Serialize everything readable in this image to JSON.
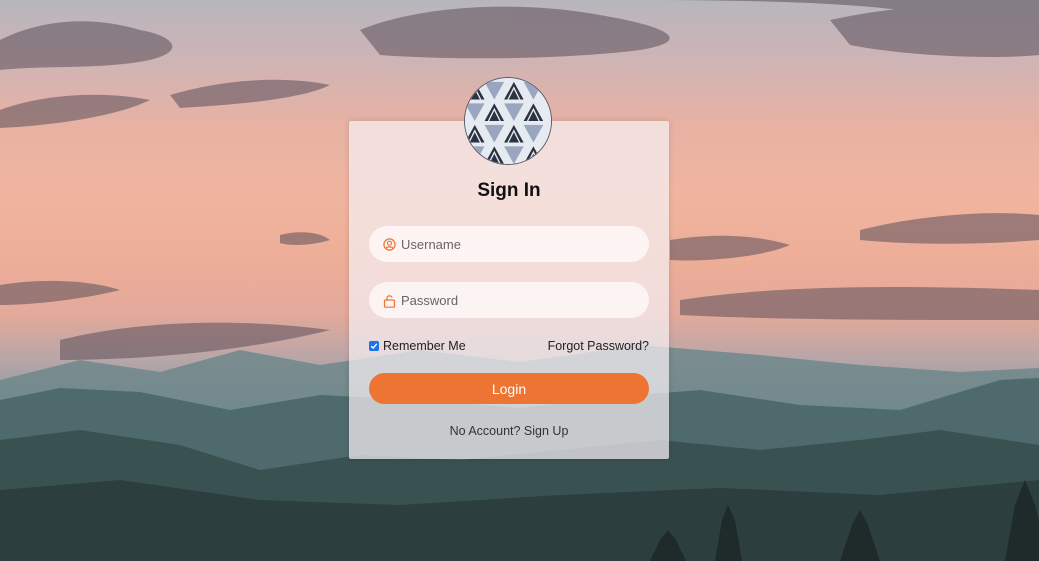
{
  "login": {
    "title": "Sign In",
    "username_placeholder": "Username",
    "password_placeholder": "Password",
    "remember_label": "Remember Me",
    "remember_checked": true,
    "forgot_label": "Forgot Password?",
    "login_label": "Login",
    "signup_label": "No Account? Sign Up"
  },
  "colors": {
    "accent": "#ee7434",
    "checkbox": "#1a73e8"
  },
  "icons": {
    "username": "user-circle-icon",
    "password": "unlock-icon",
    "logo": "triangle-pattern-logo"
  }
}
